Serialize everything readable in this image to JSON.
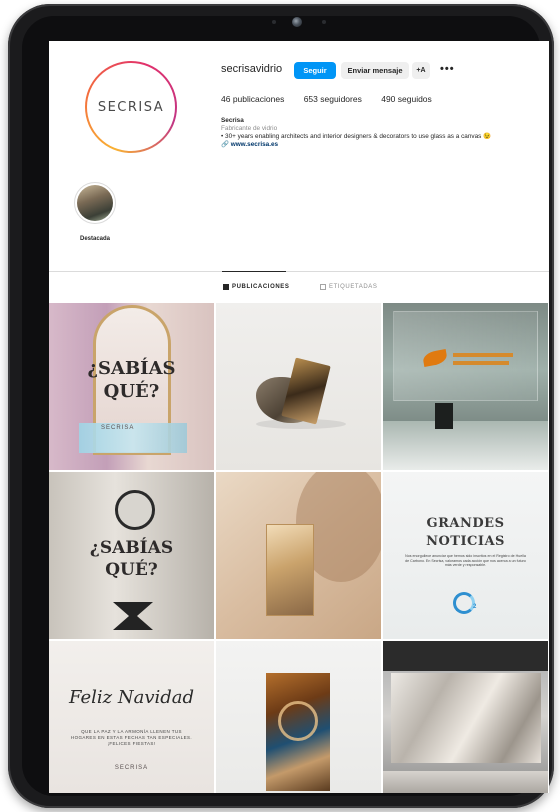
{
  "profile": {
    "username": "secrisavidrio",
    "avatar_text": "SECRISA",
    "follow_label": "Seguir",
    "message_label": "Enviar mensaje",
    "add_label": "+A",
    "more_label": "•••",
    "stats": {
      "posts": "46 publicaciones",
      "followers": "653 seguidores",
      "following": "490 seguidos"
    },
    "bio": {
      "name": "Secrisa",
      "category": "Fabricante de vidrio",
      "text": "• 30+ years enabling architects and interior designers & decorators to use glass as a canvas 😉",
      "link": "www.secrisa.es"
    }
  },
  "highlights": [
    {
      "label": "Destacada"
    }
  ],
  "tabs": {
    "posts": "PUBLICACIONES",
    "tagged": "ETIQUETADAS"
  },
  "posts": {
    "p1": {
      "line1": "¿SABÍAS",
      "line2": "QUÉ?",
      "logo": "SECRISA"
    },
    "p4": {
      "line1": "¿SABÍAS",
      "line2": "QUÉ?"
    },
    "p6": {
      "line1": "GRANDES",
      "line2": "NOTICIAS",
      "text": "Nos enorgullece anunciar que hemos sido inscritos en el Registro de Huella de Carbono. En Secrisa, valoramos cada acción que nos acerca a un futuro más verde y responsable.",
      "badge": "2"
    },
    "p7": {
      "title": "Feliz Navidad",
      "text": "QUE LA PAZ Y LA ARMONÍA LLENEN TUS HOGARES EN ESTAS FECHAS TAN ESPECIALES. ¡FELICES FIESTAS!",
      "logo": "SECRISA"
    }
  },
  "colors": {
    "follow_button": "#0095f6",
    "link": "#00376b",
    "muted": "#8e8e8e"
  }
}
